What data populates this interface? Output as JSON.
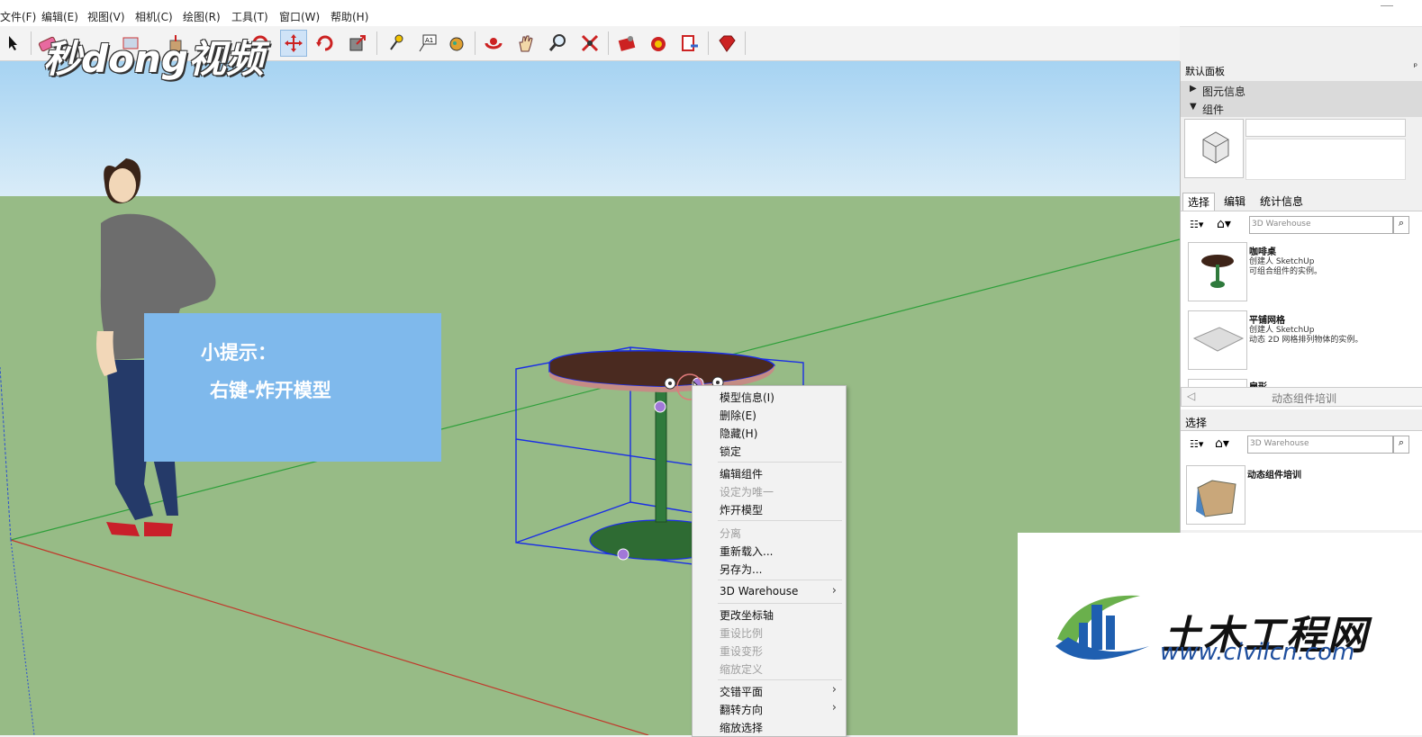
{
  "menubar": {
    "items": [
      "文件(F)",
      "编辑(E)",
      "视图(V)",
      "相机(C)",
      "绘图(R)",
      "工具(T)",
      "窗口(W)",
      "帮助(H)"
    ]
  },
  "toolbar": {
    "tools": [
      "select-arrow",
      "eraser",
      "paint",
      "rectangle",
      "pushpull",
      "move",
      "rotate",
      "scale",
      "tape-measure",
      "text",
      "paint-bucket",
      "orbit",
      "pan",
      "zoom",
      "zoom-extents",
      "warehouse-get",
      "warehouse-share",
      "components",
      "extensions"
    ]
  },
  "tip": {
    "line1": "小提示：",
    "line2": "右键-炸开模型"
  },
  "context_menu": {
    "items": [
      {
        "label": "模型信息(I)",
        "disabled": false
      },
      {
        "label": "删除(E)",
        "disabled": false
      },
      {
        "label": "隐藏(H)",
        "disabled": false
      },
      {
        "label": "锁定",
        "disabled": false
      },
      {
        "label": "编辑组件",
        "disabled": false
      },
      {
        "label": "设定为唯一",
        "disabled": true
      },
      {
        "label": "炸开模型",
        "disabled": false
      },
      {
        "label": "分离",
        "disabled": true
      },
      {
        "label": "重新载入...",
        "disabled": false
      },
      {
        "label": "另存为...",
        "disabled": false
      },
      {
        "label": "3D Warehouse",
        "disabled": false,
        "submenu": true
      },
      {
        "label": "更改坐标轴",
        "disabled": false
      },
      {
        "label": "重设比例",
        "disabled": true
      },
      {
        "label": "重设变形",
        "disabled": true
      },
      {
        "label": "缩放定义",
        "disabled": true
      },
      {
        "label": "交错平面",
        "disabled": false,
        "submenu": true
      },
      {
        "label": "翻转方向",
        "disabled": false,
        "submenu": true
      },
      {
        "label": "缩放选择",
        "disabled": false
      }
    ],
    "submenu_glyph": "›"
  },
  "panel": {
    "title": "默认面板",
    "pin_glyph": "ᵖ",
    "sections": {
      "entity_info": "图元信息",
      "components": "组件"
    },
    "tabs": [
      "选择",
      "编辑",
      "统计信息"
    ],
    "search_placeholder": "3D Warehouse",
    "components_list": [
      {
        "name": "咖啡桌",
        "author": "创建人 SketchUp",
        "desc": "可组合组件的实例。"
      },
      {
        "name": "平铺网格",
        "author": "创建人 SketchUp",
        "desc": "动态 2D 网格排列物体的实例。"
      },
      {
        "name": "扇形",
        "author": "",
        "desc": ""
      }
    ],
    "collection_label": "动态组件培训",
    "lower_title": "选择",
    "lower_item": "动态组件培训"
  },
  "watermarks": {
    "miaodong": "秒dong视频",
    "civil_cn": "土木工程网",
    "civil_url": "www.civilcn.com"
  },
  "colors": {
    "sky_top": "#a6d3f2",
    "ground": "#97bb86",
    "tip_bg": "#7fb9ec",
    "selection_blue": "#1a2ee6",
    "axis_red": "#c0392b",
    "axis_green": "#2e9f3a"
  }
}
